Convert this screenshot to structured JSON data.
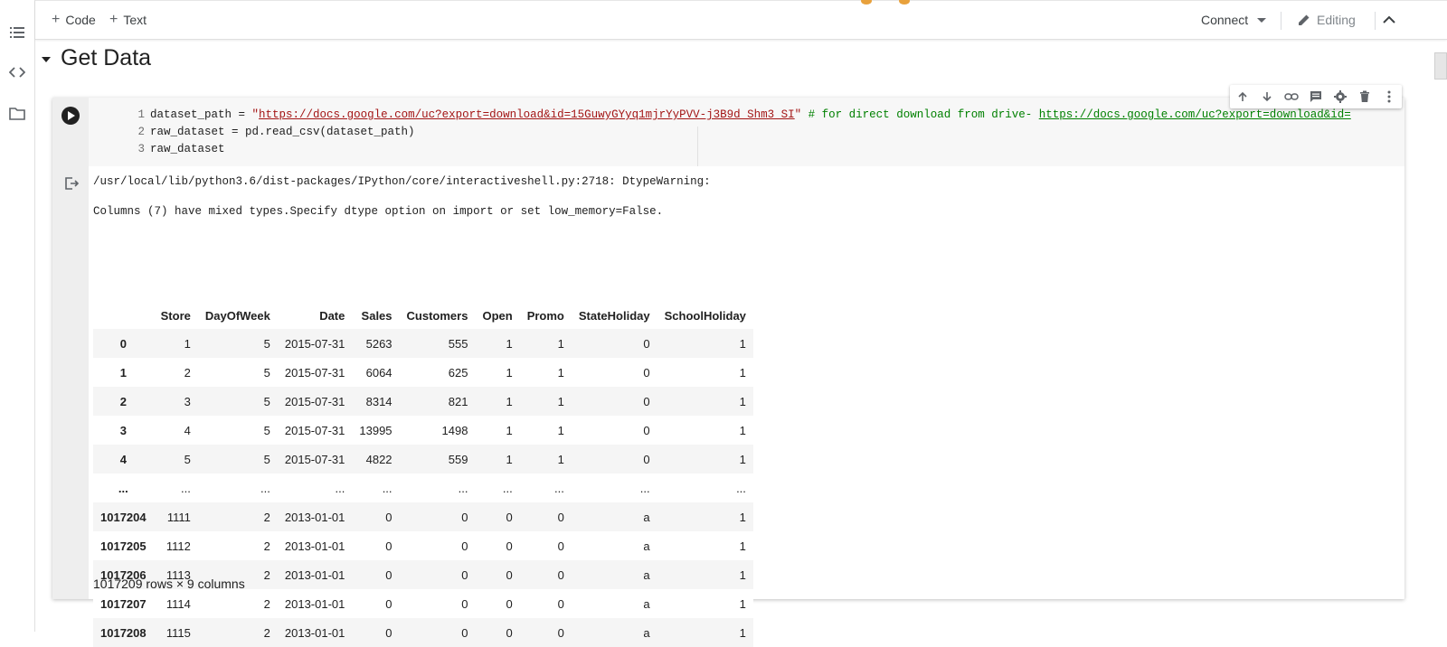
{
  "toolbar": {
    "add_code": "Code",
    "add_text": "Text",
    "connect": "Connect",
    "editing": "Editing"
  },
  "section": {
    "title": "Get Data"
  },
  "code": {
    "lines": [
      {
        "num": "1",
        "pre": "dataset_path = ",
        "q1": "\"",
        "url": "https://docs.google.com/uc?export=download&id=15GuwyGYyq1mjrYyPVV-j3B9d_Shm3_SI",
        "q2": "\"",
        "comment_pre": " # for direct download from drive- ",
        "comment_link": "https://docs.google.com/uc?export=download&id="
      },
      {
        "num": "2",
        "text": "raw_dataset = pd.read_csv(dataset_path)"
      },
      {
        "num": "3",
        "text": "raw_dataset"
      }
    ]
  },
  "output": {
    "warning_line1": "/usr/local/lib/python3.6/dist-packages/IPython/core/interactiveshell.py:2718: DtypeWarning:",
    "warning_line2": "Columns (7) have mixed types.Specify dtype option on import or set low_memory=False.",
    "columns": [
      "",
      "Store",
      "DayOfWeek",
      "Date",
      "Sales",
      "Customers",
      "Open",
      "Promo",
      "StateHoliday",
      "SchoolHoliday"
    ],
    "rows": [
      [
        "0",
        "1",
        "5",
        "2015-07-31",
        "5263",
        "555",
        "1",
        "1",
        "0",
        "1"
      ],
      [
        "1",
        "2",
        "5",
        "2015-07-31",
        "6064",
        "625",
        "1",
        "1",
        "0",
        "1"
      ],
      [
        "2",
        "3",
        "5",
        "2015-07-31",
        "8314",
        "821",
        "1",
        "1",
        "0",
        "1"
      ],
      [
        "3",
        "4",
        "5",
        "2015-07-31",
        "13995",
        "1498",
        "1",
        "1",
        "0",
        "1"
      ],
      [
        "4",
        "5",
        "5",
        "2015-07-31",
        "4822",
        "559",
        "1",
        "1",
        "0",
        "1"
      ],
      [
        "...",
        "...",
        "...",
        "...",
        "...",
        "...",
        "...",
        "...",
        "...",
        "..."
      ],
      [
        "1017204",
        "1111",
        "2",
        "2013-01-01",
        "0",
        "0",
        "0",
        "0",
        "a",
        "1"
      ],
      [
        "1017205",
        "1112",
        "2",
        "2013-01-01",
        "0",
        "0",
        "0",
        "0",
        "a",
        "1"
      ],
      [
        "1017206",
        "1113",
        "2",
        "2013-01-01",
        "0",
        "0",
        "0",
        "0",
        "a",
        "1"
      ],
      [
        "1017207",
        "1114",
        "2",
        "2013-01-01",
        "0",
        "0",
        "0",
        "0",
        "a",
        "1"
      ],
      [
        "1017208",
        "1115",
        "2",
        "2013-01-01",
        "0",
        "0",
        "0",
        "0",
        "a",
        "1"
      ]
    ],
    "shape": "1017209 rows × 9 columns"
  },
  "icons": {
    "rail": [
      "toc-icon",
      "code-snippets-icon",
      "files-icon"
    ],
    "cell_toolbar": [
      "arrow-up-icon",
      "arrow-down-icon",
      "link-icon",
      "comment-icon",
      "gear-icon",
      "delete-icon",
      "more-vert-icon"
    ]
  },
  "colors": {
    "string": "#a31515",
    "comment": "#008000",
    "gutter": "#eeeeee",
    "code_bg": "#f7f7f7"
  }
}
